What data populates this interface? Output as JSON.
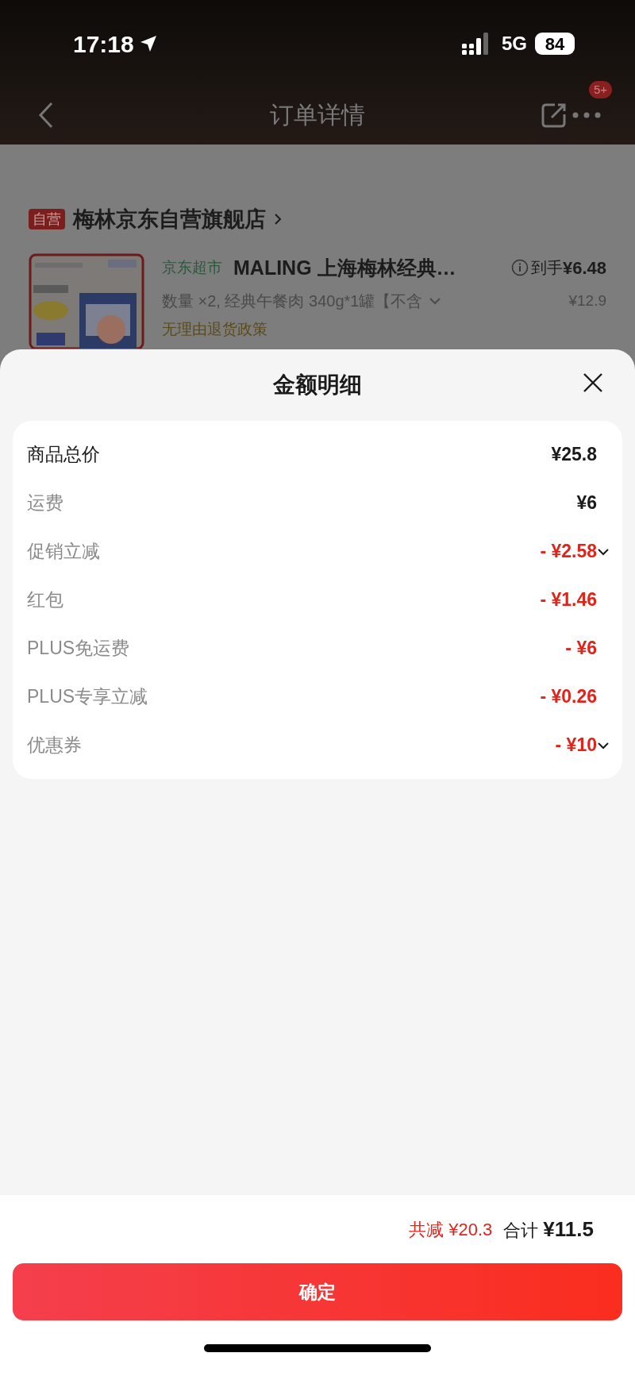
{
  "status_bar": {
    "time": "17:18",
    "network": "5G",
    "battery": "84"
  },
  "nav": {
    "title": "订单详情",
    "badge": "5+"
  },
  "store": {
    "tag": "自营",
    "name": "梅林京东自营旗舰店"
  },
  "product": {
    "channel": "京东超市",
    "title": "MALING 上海梅林经典…",
    "price_label": "到手",
    "price": "¥6.48",
    "spec": "数量 ×2, 经典午餐肉 340g*1罐【不含",
    "original_price": "¥12.9",
    "policy": "无理由退货政策"
  },
  "sheet": {
    "title": "金额明细",
    "rows": [
      {
        "label": "商品总价",
        "value": "¥25.8",
        "kind": "subtotal",
        "dropdown": false
      },
      {
        "label": "运费",
        "value": "¥6",
        "kind": "charge",
        "dropdown": false
      },
      {
        "label": "促销立减",
        "value": "- ¥2.58",
        "kind": "discount",
        "dropdown": true
      },
      {
        "label": "红包",
        "value": "- ¥1.46",
        "kind": "discount",
        "dropdown": false
      },
      {
        "label": "PLUS免运费",
        "value": "- ¥6",
        "kind": "discount",
        "dropdown": false
      },
      {
        "label": "PLUS专享立减",
        "value": "- ¥0.26",
        "kind": "discount",
        "dropdown": false
      },
      {
        "label": "优惠券",
        "value": "- ¥10",
        "kind": "discount",
        "dropdown": true
      }
    ],
    "saved": "共减 ¥20.3",
    "total_label": "合计",
    "total": "¥11.5",
    "confirm": "确定"
  }
}
